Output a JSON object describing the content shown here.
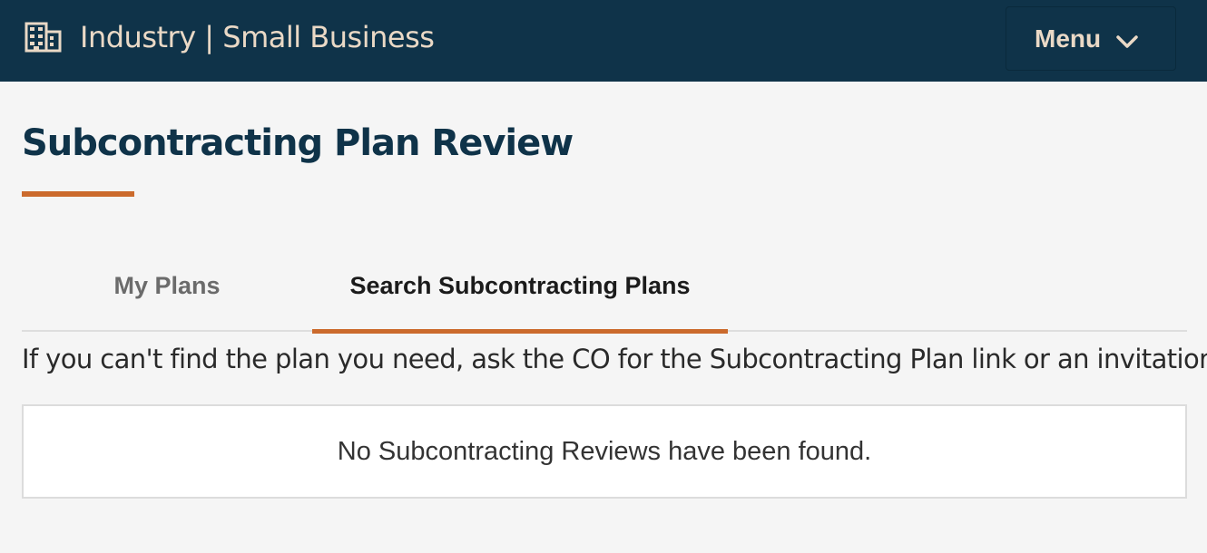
{
  "header": {
    "icon": "building-icon",
    "brand": "Industry | Small Business",
    "menu_label": "Menu",
    "menu_icon": "chevron-down-icon",
    "background_color": "#0f3349",
    "text_color": "#ead9c6"
  },
  "page": {
    "title": "Subcontracting Plan Review",
    "accent_color": "#cb6a2c"
  },
  "tabs": [
    {
      "label": "My Plans",
      "active": false
    },
    {
      "label": "Search Subcontracting Plans",
      "active": true
    }
  ],
  "hint": "If you can't find the plan you need, ask the CO for the Subcontracting Plan link or an invitation.",
  "results": {
    "empty_message": "No Subcontracting Reviews have been found."
  }
}
